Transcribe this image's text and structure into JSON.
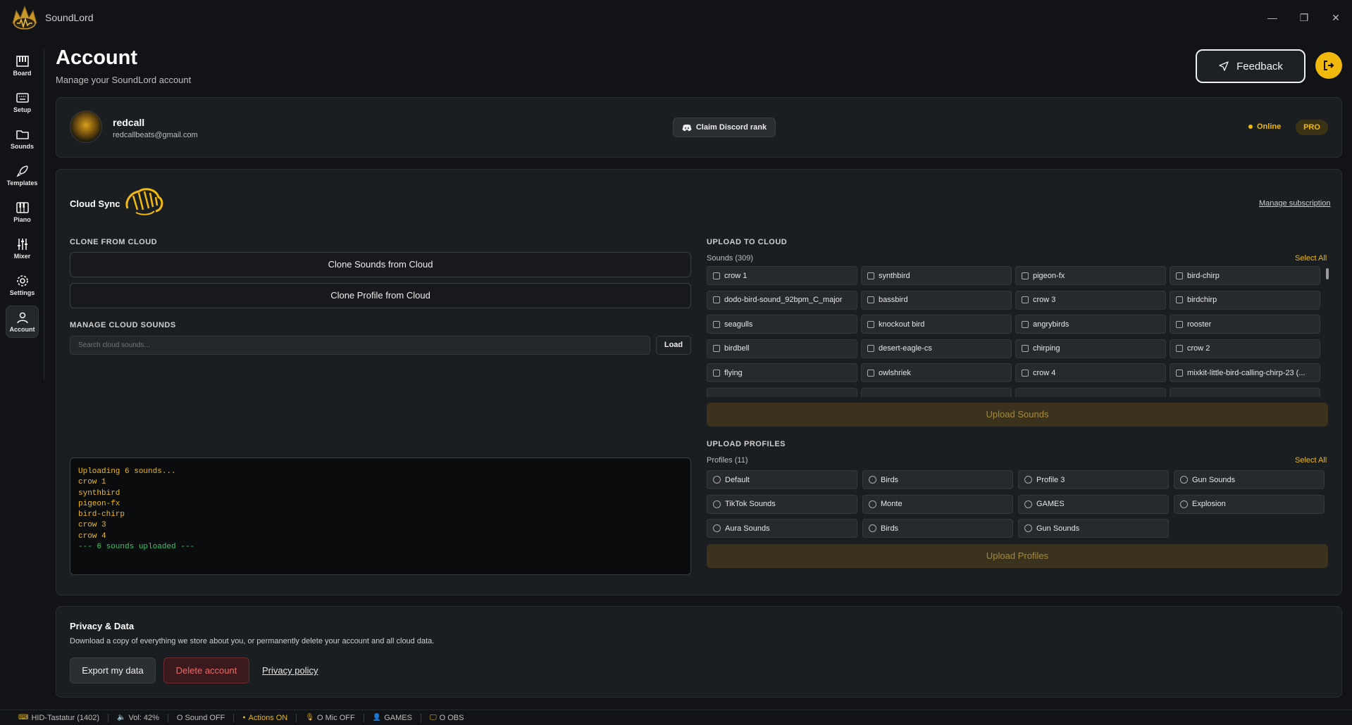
{
  "app": {
    "title": "SoundLord"
  },
  "window": {
    "minimize": "—",
    "restore": "❐",
    "close": "✕"
  },
  "sidebar": {
    "items": [
      {
        "label": "Board",
        "icon": "piano-keys-icon"
      },
      {
        "label": "Setup",
        "icon": "keyboard-icon"
      },
      {
        "label": "Sounds",
        "icon": "folder-icon"
      },
      {
        "label": "Templates",
        "icon": "rocket-icon"
      },
      {
        "label": "Piano",
        "icon": "piano-icon"
      },
      {
        "label": "Mixer",
        "icon": "sliders-icon"
      },
      {
        "label": "Settings",
        "icon": "gear-icon"
      },
      {
        "label": "Account",
        "icon": "user-icon",
        "active": true
      }
    ]
  },
  "header": {
    "title": "Account",
    "subtitle": "Manage your SoundLord account",
    "feedback_label": "Feedback"
  },
  "profile": {
    "name": "redcall",
    "email": "redcallbeats@gmail.com",
    "discord_label": "Claim Discord rank",
    "status": "Online",
    "badge": "PRO"
  },
  "cloud": {
    "title": "Cloud Sync",
    "manage_subscription": "Manage subscription",
    "clone_heading": "CLONE FROM CLOUD",
    "clone_sounds": "Clone Sounds from Cloud",
    "clone_profile": "Clone Profile from Cloud",
    "manage_heading": "MANAGE CLOUD SOUNDS",
    "search_placeholder": "Search cloud sounds...",
    "load_label": "Load",
    "console": [
      {
        "text": "Uploading 6 sounds...",
        "color": "yellow"
      },
      {
        "text": "crow 1",
        "color": "yellow"
      },
      {
        "text": "synthbird",
        "color": "yellow"
      },
      {
        "text": "pigeon-fx",
        "color": "yellow"
      },
      {
        "text": "bird-chirp",
        "color": "yellow"
      },
      {
        "text": "crow 3",
        "color": "yellow"
      },
      {
        "text": "crow 4",
        "color": "yellow"
      },
      {
        "text": "--- 6 sounds uploaded ---",
        "color": "green"
      }
    ],
    "upload_heading": "UPLOAD TO CLOUD",
    "sounds_count": "Sounds (309)",
    "select_all": "Select All",
    "sounds": [
      "crow 1",
      "synthbird",
      "pigeon-fx",
      "bird-chirp",
      "dodo-bird-sound_92bpm_C_major",
      "bassbird",
      "crow 3",
      "birdchirp",
      "seagulls",
      "knockout bird",
      "angrybirds",
      "rooster",
      "birdbell",
      "desert-eagle-cs",
      "chirping",
      "crow 2",
      "flying",
      "owlshriek",
      "crow 4",
      "mixkit-little-bird-calling-chirp-23 (..."
    ],
    "upload_sounds": "Upload Sounds",
    "profiles_heading": "UPLOAD PROFILES",
    "profiles_count": "Profiles (11)",
    "profiles": [
      "Default",
      "Birds",
      "Profile 3",
      "Gun Sounds",
      "TikTok Sounds",
      "Monte",
      "GAMES",
      "Explosion",
      "Aura Sounds",
      "Birds",
      "Gun Sounds"
    ],
    "upload_profiles": "Upload Profiles"
  },
  "privacy": {
    "title": "Privacy & Data",
    "description": "Download a copy of everything we store about you, or permanently delete your account and all cloud data.",
    "export_label": "Export my data",
    "delete_label": "Delete account",
    "policy_label": "Privacy policy"
  },
  "status": [
    {
      "text": "HID-Tastatur (1402)",
      "icon": "keyboard-icon"
    },
    {
      "text": "Vol: 42%",
      "icon": "volume-icon"
    },
    {
      "text": "O Sound OFF",
      "icon": ""
    },
    {
      "text": "Actions ON",
      "icon": "dot",
      "on": true
    },
    {
      "text": "O Mic OFF",
      "icon": "mic-icon"
    },
    {
      "text": "GAMES",
      "icon": "user-icon"
    },
    {
      "text": "O OBS",
      "icon": "monitor-icon"
    }
  ],
  "colors": {
    "accent": "#f0b90b",
    "background": "#111316",
    "card": "#1b1e21",
    "danger": "#f06a6a",
    "success": "#3ec46d"
  }
}
